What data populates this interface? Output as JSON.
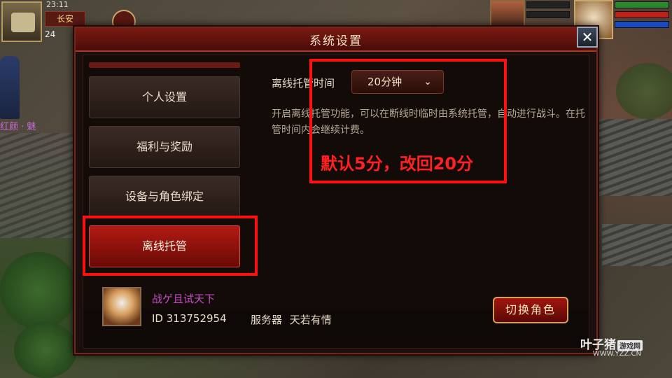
{
  "hud": {
    "clock": "23:11",
    "city": "长安",
    "num": "24",
    "left_name": "红颜 · 魅"
  },
  "dialog": {
    "title": "系统设置",
    "close": "✕"
  },
  "sidebar": {
    "items": [
      {
        "label": "个人设置"
      },
      {
        "label": "福利与奖励"
      },
      {
        "label": "设备与角色绑定"
      },
      {
        "label": "离线托管"
      }
    ]
  },
  "offline": {
    "label": "离线托管时间",
    "select_value": "20分钟",
    "chevron": "⌄",
    "description": "开启离线托管功能，可以在断线时临时由系统托管，自动进行战斗。在托管时间内会继续计费。"
  },
  "annotation": {
    "note": "默认5分，改回20分"
  },
  "player": {
    "name": "战ゲ且试天下",
    "id": "ID 313752954",
    "server_label": "服务器",
    "server_name": "天若有情",
    "switch_label": "切换角色"
  },
  "watermark": {
    "main": "叶子猪",
    "badge": "游戏网",
    "url": "WWW.YZZ.CN"
  },
  "colors": {
    "accent_red": "#b21a14",
    "annotation": "#ff1010",
    "player_name": "#c84ac8"
  }
}
